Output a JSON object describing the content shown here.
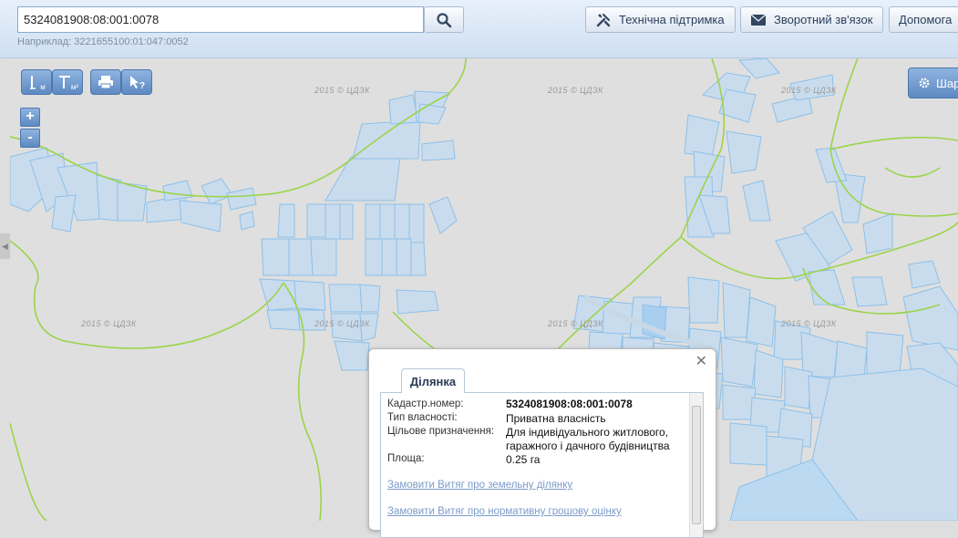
{
  "search": {
    "value": "5324081908:08:001:0078",
    "hint": "Наприклад: 3221655100:01:047:0052"
  },
  "header": {
    "support_label": "Технічна підтримка",
    "feedback_label": "Зворотний зв'язок",
    "help_label": "Допомога"
  },
  "map": {
    "watermark": "2015 © ЦДЗК",
    "layers_label": "Шар",
    "tools": {
      "ruler_unit": "м",
      "area_unit": "м²"
    },
    "zoom_in": "+",
    "zoom_out": "-",
    "colors": {
      "background": "#dfdfdf",
      "parcel_fill": "#c9dcee",
      "parcel_stroke": "#8cc0e8",
      "boundary": "#9bd44a"
    }
  },
  "popup": {
    "tab_label": "Ділянка",
    "fields": [
      {
        "label": "Кадастр.номер:",
        "value": "5324081908:08:001:0078"
      },
      {
        "label": "Тип власності:",
        "value": "Приватна власність"
      },
      {
        "label": "Цільове призначення:",
        "value": "Для індивідуального житлового, гаражного і дачного будівництва"
      },
      {
        "label": "Площа:",
        "value": "0.25 га"
      }
    ],
    "links": [
      "Замовити Витяг про земельну ділянку",
      "Замовити Витяг про нормативну грошову оцінку"
    ]
  }
}
